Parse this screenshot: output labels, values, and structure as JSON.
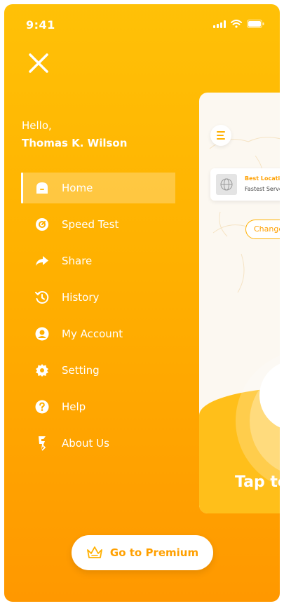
{
  "status_bar": {
    "time": "9:41"
  },
  "greeting": {
    "hello": "Hello,",
    "name": "Thomas K. Wilson"
  },
  "menu": {
    "items": [
      {
        "label": "Home",
        "icon": "home-icon",
        "active": true
      },
      {
        "label": "Speed Test",
        "icon": "speedometer-icon"
      },
      {
        "label": "Share",
        "icon": "share-icon"
      },
      {
        "label": "History",
        "icon": "history-icon"
      },
      {
        "label": "My Account",
        "icon": "account-icon"
      },
      {
        "label": "Setting",
        "icon": "gear-icon"
      },
      {
        "label": "Help",
        "icon": "help-icon"
      },
      {
        "label": "About Us",
        "icon": "logo-icon"
      }
    ]
  },
  "preview": {
    "location_title": "Best Location",
    "location_subtitle": "Fastest Server",
    "change_label": "Change",
    "tap_text": "Tap to"
  },
  "premium_button": {
    "label": "Go to Premium",
    "icon": "crown-icon"
  },
  "colors": {
    "accent": "#ffb000",
    "gradient_top": "#ffc107",
    "gradient_bottom": "#ff9800",
    "text_on_accent": "#ffffff"
  }
}
